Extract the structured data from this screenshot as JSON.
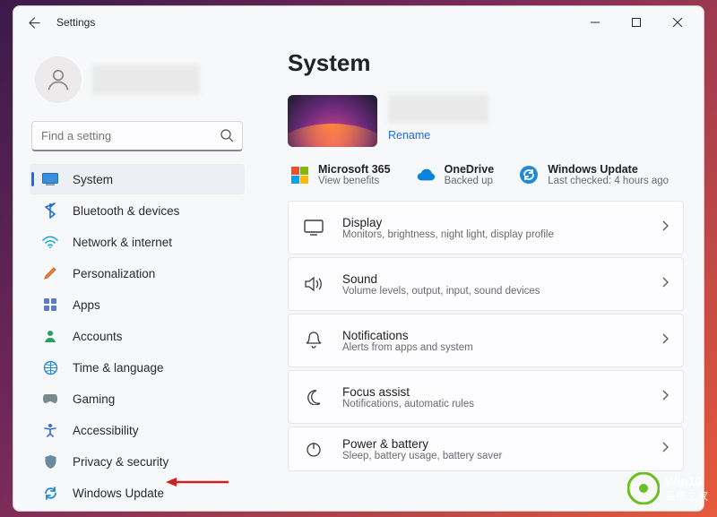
{
  "window": {
    "title": "Settings"
  },
  "search": {
    "placeholder": "Find a setting"
  },
  "sidebar": {
    "items": [
      {
        "label": "System"
      },
      {
        "label": "Bluetooth & devices"
      },
      {
        "label": "Network & internet"
      },
      {
        "label": "Personalization"
      },
      {
        "label": "Apps"
      },
      {
        "label": "Accounts"
      },
      {
        "label": "Time & language"
      },
      {
        "label": "Gaming"
      },
      {
        "label": "Accessibility"
      },
      {
        "label": "Privacy & security"
      },
      {
        "label": "Windows Update"
      }
    ]
  },
  "page": {
    "heading": "System",
    "rename": "Rename",
    "status": [
      {
        "title": "Microsoft 365",
        "sub": "View benefits"
      },
      {
        "title": "OneDrive",
        "sub": "Backed up"
      },
      {
        "title": "Windows Update",
        "sub": "Last checked: 4 hours ago"
      }
    ],
    "items": [
      {
        "title": "Display",
        "sub": "Monitors, brightness, night light, display profile"
      },
      {
        "title": "Sound",
        "sub": "Volume levels, output, input, sound devices"
      },
      {
        "title": "Notifications",
        "sub": "Alerts from apps and system"
      },
      {
        "title": "Focus assist",
        "sub": "Notifications, automatic rules"
      },
      {
        "title": "Power & battery",
        "sub": "Sleep, battery usage, battery saver"
      }
    ]
  },
  "watermark": {
    "line1": "Win10",
    "line2": "系统之家"
  }
}
